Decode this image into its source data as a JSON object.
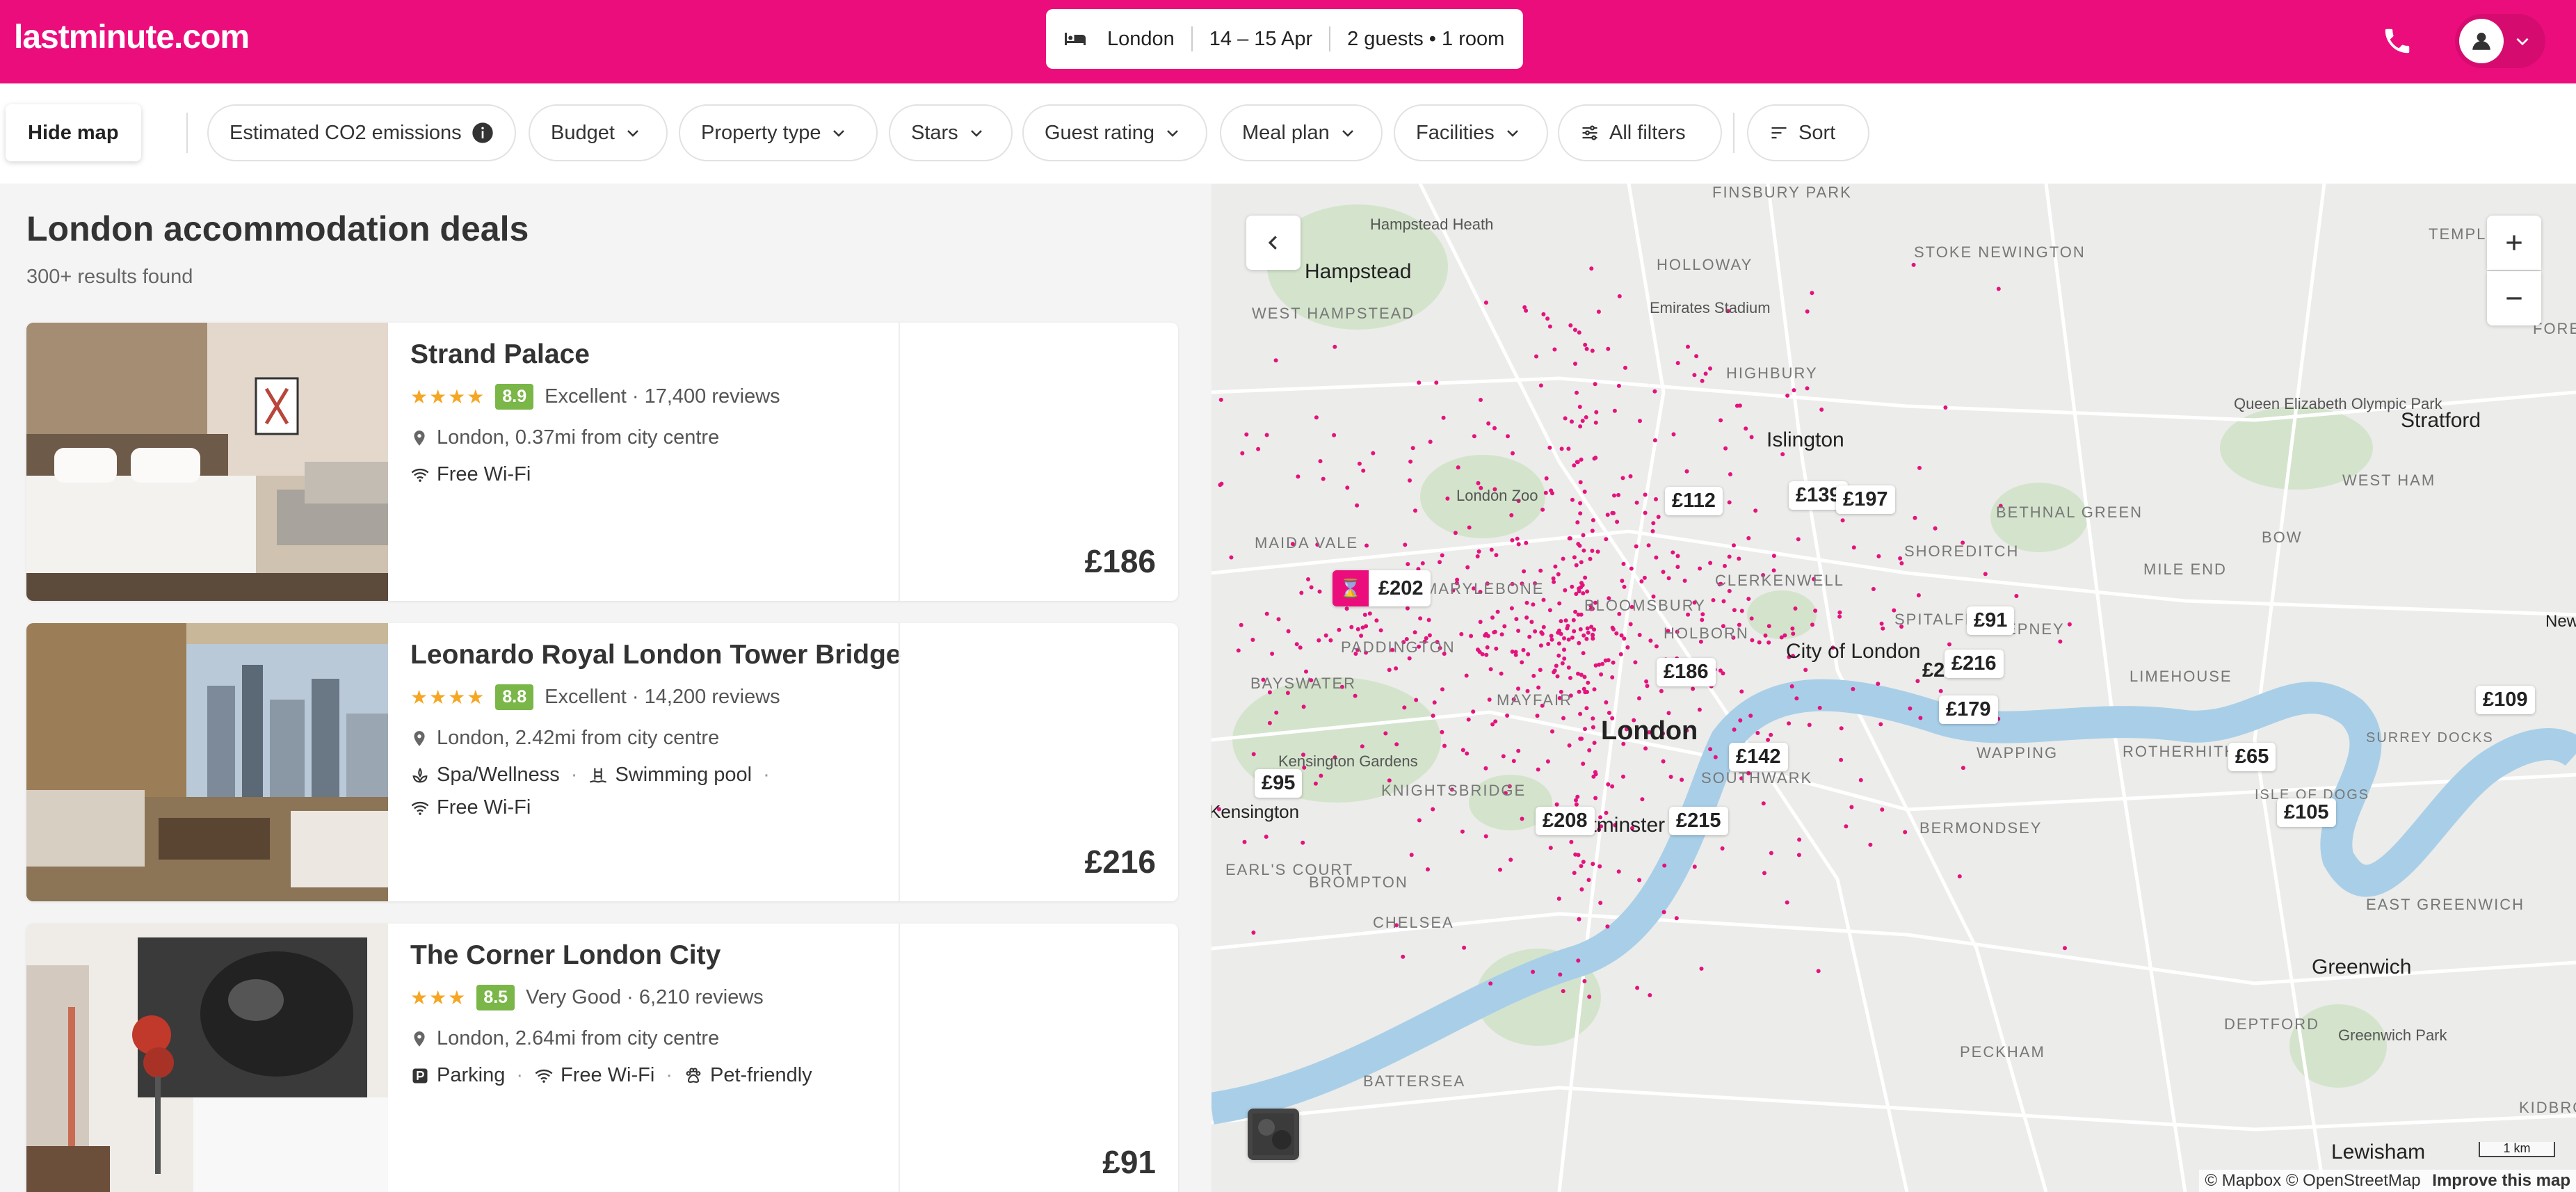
{
  "header": {
    "logo": "lastminute.com",
    "search": {
      "destination": "London",
      "dates": "14 – 15 Apr",
      "guests": "2 guests • 1 room"
    },
    "icons": [
      "bed-icon",
      "phone-icon",
      "user-icon",
      "chevron-down-icon"
    ],
    "brand_color": "#ec0d7d"
  },
  "filters": {
    "hide_map": "Hide map",
    "co2": "Estimated CO2 emissions",
    "budget": "Budget",
    "property_type": "Property type",
    "stars": "Stars",
    "guest_rating": "Guest rating",
    "meal_plan": "Meal plan",
    "facilities": "Facilities",
    "all_filters": "All filters",
    "sort": "Sort"
  },
  "results": {
    "title": "London accommodation deals",
    "count": "300+ results found",
    "hotels": [
      {
        "name": "Strand Palace",
        "stars": "★★★★",
        "score": "8.9",
        "rating_text": "Excellent · 17,400 reviews",
        "location": "London, 0.37mi from city centre",
        "amenities": [
          "Free Wi-Fi"
        ],
        "price": "£186"
      },
      {
        "name": "Leonardo Royal London Tower Bridge",
        "stars": "★★★★",
        "score": "8.8",
        "rating_text": "Excellent · 14,200 reviews",
        "location": "London, 2.42mi from city centre",
        "amenities": [
          "Spa/Wellness",
          "Swimming pool",
          "Free Wi-Fi"
        ],
        "price": "£216"
      },
      {
        "name": "The Corner London City",
        "stars": "★★★",
        "score": "8.5",
        "rating_text": "Very Good · 6,210 reviews",
        "location": "London, 2.64mi from city centre",
        "amenities": [
          "Parking",
          "Free Wi-Fi",
          "Pet-friendly"
        ],
        "price": "£91"
      }
    ]
  },
  "map": {
    "places": {
      "hampstead": "Hampstead",
      "west_hampstead": "WEST HAMPSTEAD",
      "hampstead_heath": "Hampstead Heath",
      "finsbury_park": "FINSBURY PARK",
      "holloway": "HOLLOWAY",
      "emirates": "Emirates Stadium",
      "stoke_newington": "STOKE NEWINGTON",
      "highbury": "HIGHBURY",
      "islington": "Islington",
      "london_zoo": "London Zoo",
      "maida_vale": "MAIDA VALE",
      "marylebone": "MARYLEBONE",
      "bloomsbury": "BLOOMSBURY",
      "clerkenwell": "CLERKENWELL",
      "shoreditch": "SHOREDITCH",
      "paddington": "PADDINGTON",
      "holborn": "HOLBORN",
      "city_of_london": "City of London",
      "bayswater": "BAYSWATER",
      "mayfair": "MAYFAIR",
      "london": "London",
      "kensington_gardens": "Kensington Gardens",
      "knightsbridge": "KNIGHTSBRIDGE",
      "kensington": "Kensington",
      "southwark": "SOUTHWARK",
      "westminster": "Westminster",
      "earls_court": "EARL'S COURT",
      "brompton": "BROMPTON",
      "chelsea": "CHELSEA",
      "battersea": "BATTERSEA",
      "bermondsey": "BERMONDSEY",
      "rotherhithe": "ROTHERHITHE",
      "wapping": "WAPPING",
      "limehouse": "LIMEHOUSE",
      "stepney": "STEPNEY",
      "spitalfields": "SPITALFIELDS",
      "bethnal_green": "BETHNAL GREEN",
      "mile_end": "MILE END",
      "bow": "BOW",
      "stratford": "Stratford",
      "queen_elizabeth": "Queen Elizabeth Olympic Park",
      "west_ham": "WEST HAM",
      "temple": "TEMPLE",
      "forest_gate": "FOREST GATE",
      "greenwich": "Greenwich",
      "east_greenwich": "EAST GREENWICH",
      "greenwich_park": "Greenwich Park",
      "deptford": "DEPTFORD",
      "peckham": "PECKHAM",
      "lewisham": "Lewisham",
      "kidbrooke": "KIDBRO",
      "new": "New",
      "surrey_docks": "SURREY DOCKS",
      "isle_of_dogs": "ISLE OF DOGS"
    },
    "prices": [
      "£112",
      "£139",
      "£197",
      "£202",
      "£91",
      "£186",
      "£216",
      "£2",
      "£179",
      "£142",
      "£208",
      "£215",
      "£95",
      "£65",
      "£105",
      "£109"
    ],
    "scale": "1 km",
    "attribution": "© Mapbox © OpenStreetMap",
    "improve": "Improve this map"
  }
}
